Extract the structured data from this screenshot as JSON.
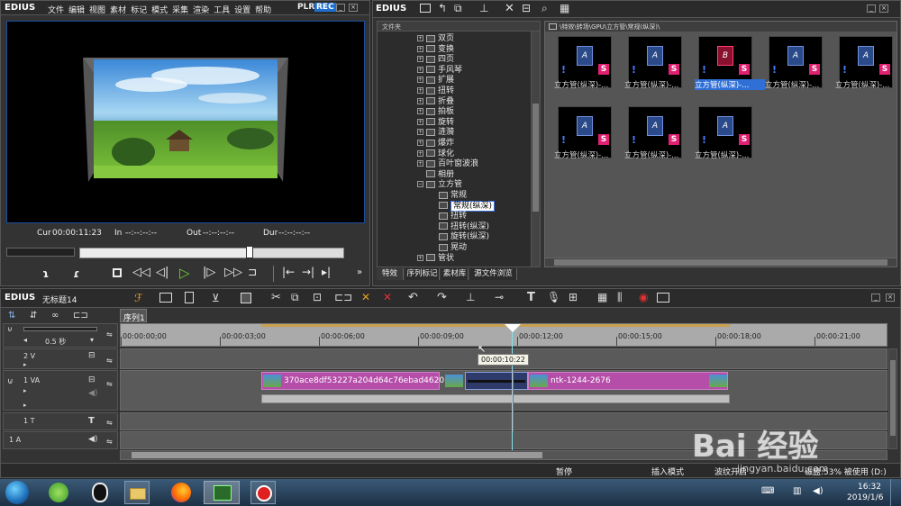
{
  "preview": {
    "brand": "EDIUS",
    "menu": [
      "文件",
      "编辑",
      "视图",
      "素材",
      "标记",
      "模式",
      "采集",
      "渲染",
      "工具",
      "设置",
      "帮助"
    ],
    "mode_plr": "PLR",
    "mode_rec": "REC",
    "cur_label": "Cur",
    "cur_value": "00:00:11:23",
    "in_label": "In",
    "in_value": "--:--:--:--",
    "out_label": "Out",
    "out_value": "--:--:--:--",
    "dur_label": "Dur",
    "dur_value": "--:--:--:--"
  },
  "bin": {
    "brand": "EDIUS",
    "folder_header": "文件夹",
    "path": "\\特效\\转场\\GPU\\立方管\\常规(纵深)\\",
    "tree": [
      {
        "label": "双页",
        "kind": "plus",
        "indent": 1
      },
      {
        "label": "变换",
        "kind": "plus",
        "indent": 1
      },
      {
        "label": "四页",
        "kind": "plus",
        "indent": 1
      },
      {
        "label": "手风琴",
        "kind": "plus",
        "indent": 1
      },
      {
        "label": "扩展",
        "kind": "plus",
        "indent": 1
      },
      {
        "label": "扭转",
        "kind": "plus",
        "indent": 1
      },
      {
        "label": "折叠",
        "kind": "plus",
        "indent": 1
      },
      {
        "label": "拍板",
        "kind": "plus",
        "indent": 1
      },
      {
        "label": "旋转",
        "kind": "plus",
        "indent": 1
      },
      {
        "label": "涟漪",
        "kind": "plus",
        "indent": 1
      },
      {
        "label": "爆炸",
        "kind": "plus",
        "indent": 1
      },
      {
        "label": "球化",
        "kind": "plus",
        "indent": 1
      },
      {
        "label": "百叶窗波浪",
        "kind": "plus",
        "indent": 1
      },
      {
        "label": "相册",
        "kind": "folder",
        "indent": 1
      },
      {
        "label": "立方管",
        "kind": "minus",
        "indent": 1
      },
      {
        "label": "常规",
        "kind": "folder",
        "indent": 2
      },
      {
        "label": "常规(纵深)",
        "kind": "folder",
        "indent": 2,
        "selected": true
      },
      {
        "label": "扭转",
        "kind": "folder",
        "indent": 2
      },
      {
        "label": "扭转(纵深)",
        "kind": "folder",
        "indent": 2
      },
      {
        "label": "旋转(纵深)",
        "kind": "folder",
        "indent": 2
      },
      {
        "label": "晃动",
        "kind": "folder",
        "indent": 2
      },
      {
        "label": "管状",
        "kind": "plus",
        "indent": 1
      }
    ],
    "tabs": [
      "特效",
      "序列标记",
      "素材库",
      "源文件浏览"
    ],
    "thumbs": [
      {
        "label": "立方管(纵深)-...",
        "letter": "A",
        "selected": false
      },
      {
        "label": "立方管(纵深)-...",
        "letter": "A",
        "selected": false
      },
      {
        "label": "立方管(纵深)-...",
        "letter": "B",
        "selected": true
      },
      {
        "label": "立方管(纵深)-...",
        "letter": "A",
        "selected": false
      },
      {
        "label": "立方管(纵深)-...",
        "letter": "A",
        "selected": false
      },
      {
        "label": "立方管(纵深)-...",
        "letter": "A",
        "selected": false
      },
      {
        "label": "立方管(纵深)-...",
        "letter": "A",
        "selected": false
      },
      {
        "label": "立方管(纵深)-...",
        "letter": "A",
        "selected": false
      }
    ]
  },
  "timeline": {
    "brand": "EDIUS",
    "project": "无标题14",
    "sequence_tab": "序列1",
    "zoom": "0.5 秒",
    "ruler": [
      "00:00:00;00",
      "00:00:03;00",
      "00:00:06;00",
      "00:00:09;00",
      "00:00:12;00",
      "00:00:15;00",
      "00:00:18;00",
      "00:00:21;00"
    ],
    "tooltip": "00:00:10:22",
    "tracks": [
      {
        "name": "2 V"
      },
      {
        "name": "1 VA"
      },
      {
        "name": "1 T"
      },
      {
        "name": "1 A"
      }
    ],
    "clip1": "370ace8df53227a204d64c76ebad4620",
    "clip2": "ntk-1244-2676"
  },
  "status": {
    "pause": "暂停",
    "insert_mode": "插入模式",
    "ripple": "波纹开启",
    "disk": "磁盘:53% 被使用 (D:)"
  },
  "taskbar": {
    "time": "16:32",
    "date": "2019/1/6"
  },
  "watermark": {
    "text": "Bai 经验",
    "url": "jingyan.baidu.com"
  }
}
